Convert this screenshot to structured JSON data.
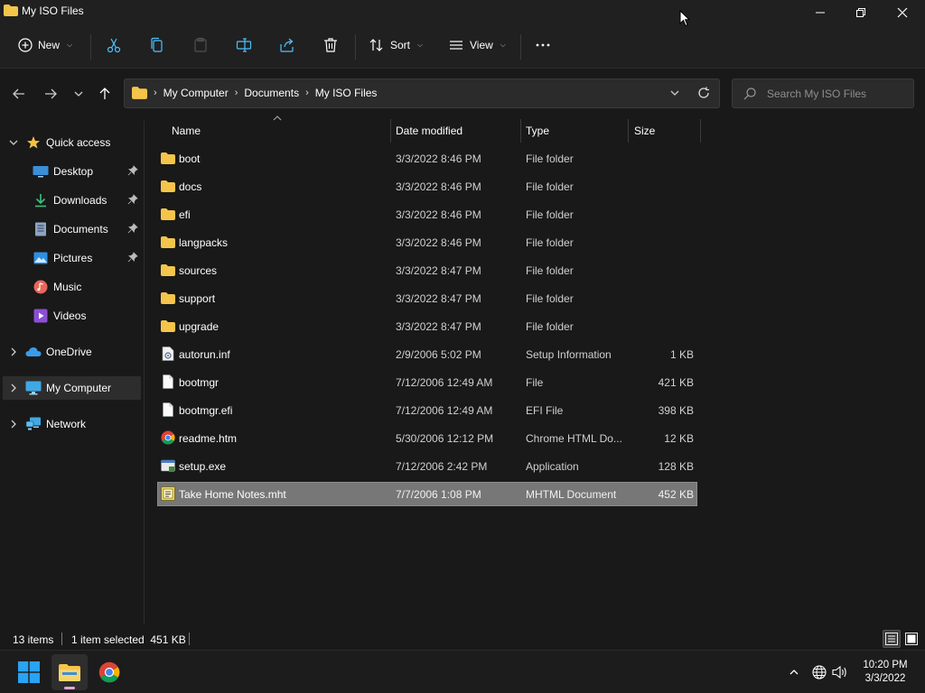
{
  "window": {
    "title": "My ISO Files"
  },
  "command_bar": {
    "new_label": "New",
    "sort_label": "Sort",
    "view_label": "View"
  },
  "address_bar": {
    "crumbs": [
      "My Computer",
      "Documents",
      "My ISO Files"
    ]
  },
  "search": {
    "placeholder": "Search My ISO Files"
  },
  "sidebar": {
    "quick_access": "Quick access",
    "pinned": [
      {
        "label": "Desktop",
        "icon": "desktop-icon"
      },
      {
        "label": "Downloads",
        "icon": "downloads-icon"
      },
      {
        "label": "Documents",
        "icon": "documents-icon"
      },
      {
        "label": "Pictures",
        "icon": "pictures-icon"
      }
    ],
    "library": [
      {
        "label": "Music",
        "icon": "music-icon"
      },
      {
        "label": "Videos",
        "icon": "videos-icon"
      }
    ],
    "onedrive": "OneDrive",
    "this_pc": "My Computer",
    "network": "Network"
  },
  "columns": {
    "name": "Name",
    "date": "Date modified",
    "type": "Type",
    "size": "Size"
  },
  "files": [
    {
      "name": "boot",
      "date": "3/3/2022 8:46 PM",
      "type": "File folder",
      "size": "",
      "icon": "folder-icon"
    },
    {
      "name": "docs",
      "date": "3/3/2022 8:46 PM",
      "type": "File folder",
      "size": "",
      "icon": "folder-icon"
    },
    {
      "name": "efi",
      "date": "3/3/2022 8:46 PM",
      "type": "File folder",
      "size": "",
      "icon": "folder-icon"
    },
    {
      "name": "langpacks",
      "date": "3/3/2022 8:46 PM",
      "type": "File folder",
      "size": "",
      "icon": "folder-icon"
    },
    {
      "name": "sources",
      "date": "3/3/2022 8:47 PM",
      "type": "File folder",
      "size": "",
      "icon": "folder-icon"
    },
    {
      "name": "support",
      "date": "3/3/2022 8:47 PM",
      "type": "File folder",
      "size": "",
      "icon": "folder-icon"
    },
    {
      "name": "upgrade",
      "date": "3/3/2022 8:47 PM",
      "type": "File folder",
      "size": "",
      "icon": "folder-icon"
    },
    {
      "name": "autorun.inf",
      "date": "2/9/2006 5:02 PM",
      "type": "Setup Information",
      "size": "1 KB",
      "icon": "setup-info-icon"
    },
    {
      "name": "bootmgr",
      "date": "7/12/2006 12:49 AM",
      "type": "File",
      "size": "421 KB",
      "icon": "file-icon"
    },
    {
      "name": "bootmgr.efi",
      "date": "7/12/2006 12:49 AM",
      "type": "EFI File",
      "size": "398 KB",
      "icon": "file-icon"
    },
    {
      "name": "readme.htm",
      "date": "5/30/2006 12:12 PM",
      "type": "Chrome HTML Do...",
      "size": "12 KB",
      "icon": "chrome-icon"
    },
    {
      "name": "setup.exe",
      "date": "7/12/2006 2:42 PM",
      "type": "Application",
      "size": "128 KB",
      "icon": "setup-exe-icon"
    },
    {
      "name": "Take Home Notes.mht",
      "date": "7/7/2006 1:08 PM",
      "type": "MHTML Document",
      "size": "452 KB",
      "icon": "mhtml-icon",
      "selected": true
    }
  ],
  "status": {
    "item_count": "13 items",
    "selection": "1 item selected  451 KB"
  },
  "taskbar": {
    "time": "10:20 PM",
    "date": "3/3/2022"
  },
  "colors": {
    "folder": "#f4c54a",
    "accent": "#4cc2ff",
    "selected_row": "#777777"
  }
}
